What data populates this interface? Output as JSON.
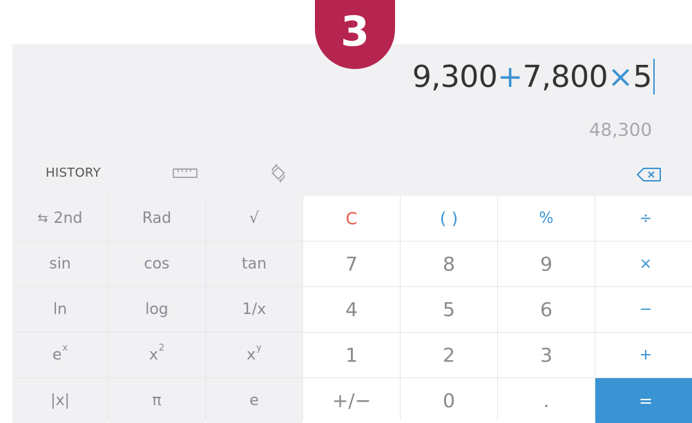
{
  "step_badge": "3",
  "display": {
    "expression": [
      {
        "text": "9,300",
        "op": false
      },
      {
        "text": "+",
        "op": true
      },
      {
        "text": "7,800",
        "op": false
      },
      {
        "text": "×",
        "op": true
      },
      {
        "text": "5",
        "op": false
      }
    ],
    "result": "48,300"
  },
  "toolbar": {
    "history_label": "HISTORY",
    "icons": [
      "ruler-icon",
      "rotate-icon",
      "backspace-icon"
    ]
  },
  "keys": [
    {
      "name": "second-function-key",
      "label": "2nd",
      "icon": "swap-arrows-icon",
      "kind": "sci"
    },
    {
      "name": "rad-key",
      "label": "Rad",
      "kind": "sci"
    },
    {
      "name": "sqrt-key",
      "label": "√",
      "kind": "sci"
    },
    {
      "name": "clear-key",
      "label": "C",
      "kind": "clear"
    },
    {
      "name": "parentheses-key",
      "label": "( )",
      "kind": "paren"
    },
    {
      "name": "percent-key",
      "label": "%",
      "kind": "op"
    },
    {
      "name": "divide-key",
      "label": "÷",
      "kind": "op"
    },
    {
      "name": "sin-key",
      "label": "sin",
      "kind": "sci"
    },
    {
      "name": "cos-key",
      "label": "cos",
      "kind": "sci"
    },
    {
      "name": "tan-key",
      "label": "tan",
      "kind": "sci"
    },
    {
      "name": "digit-7-key",
      "label": "7",
      "kind": "num"
    },
    {
      "name": "digit-8-key",
      "label": "8",
      "kind": "num"
    },
    {
      "name": "digit-9-key",
      "label": "9",
      "kind": "num"
    },
    {
      "name": "multiply-key",
      "label": "×",
      "kind": "op"
    },
    {
      "name": "ln-key",
      "label": "ln",
      "kind": "sci"
    },
    {
      "name": "log-key",
      "label": "log",
      "kind": "sci"
    },
    {
      "name": "reciprocal-key",
      "label": "1/x",
      "kind": "sci"
    },
    {
      "name": "digit-4-key",
      "label": "4",
      "kind": "num"
    },
    {
      "name": "digit-5-key",
      "label": "5",
      "kind": "num"
    },
    {
      "name": "digit-6-key",
      "label": "6",
      "kind": "num"
    },
    {
      "name": "subtract-key",
      "label": "−",
      "kind": "op"
    },
    {
      "name": "exp-key",
      "label": "e",
      "sup": "x",
      "kind": "sci"
    },
    {
      "name": "square-key",
      "label": "x",
      "sup": "2",
      "kind": "sci"
    },
    {
      "name": "power-key",
      "label": "x",
      "sup": "y",
      "kind": "sci"
    },
    {
      "name": "digit-1-key",
      "label": "1",
      "kind": "num"
    },
    {
      "name": "digit-2-key",
      "label": "2",
      "kind": "num"
    },
    {
      "name": "digit-3-key",
      "label": "3",
      "kind": "num"
    },
    {
      "name": "add-key",
      "label": "+",
      "kind": "op"
    },
    {
      "name": "abs-key",
      "label": "|x|",
      "kind": "sci"
    },
    {
      "name": "pi-key",
      "label": "π",
      "kind": "sci"
    },
    {
      "name": "euler-key",
      "label": "e",
      "kind": "sci"
    },
    {
      "name": "negate-key",
      "label": "+/−",
      "kind": "num"
    },
    {
      "name": "digit-0-key",
      "label": "0",
      "kind": "num"
    },
    {
      "name": "decimal-key",
      "label": ".",
      "kind": "num"
    },
    {
      "name": "equals-key",
      "label": "=",
      "kind": "equals"
    }
  ],
  "colors": {
    "accent": "#3a93d2",
    "clear": "#e35b4a",
    "badge": "#b5254f",
    "panel": "#f1f1f3"
  }
}
